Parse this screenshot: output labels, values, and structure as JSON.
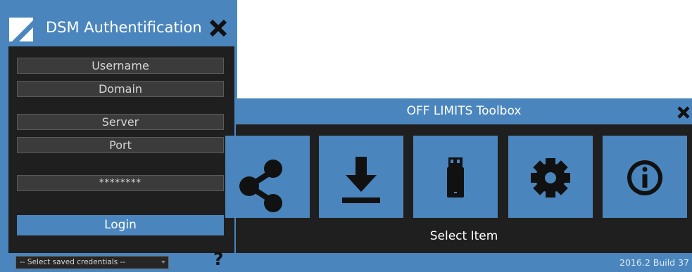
{
  "auth_window": {
    "title": "DSM Authentification",
    "fields": {
      "username": "Username",
      "domain": "Domain",
      "server": "Server",
      "port": "Port",
      "password": "********"
    },
    "login_label": "Login",
    "saved_credentials": "-- Select saved credentials --",
    "help_label": "?"
  },
  "toolbox_window": {
    "title": "OFF LIMITS Toolbox",
    "tiles": [
      {
        "icon": "share-icon"
      },
      {
        "icon": "download-icon"
      },
      {
        "icon": "usb-drive-icon"
      },
      {
        "icon": "gear-icon"
      },
      {
        "icon": "info-icon"
      }
    ],
    "status": "Select Item",
    "build": "2016.2 Build 37"
  },
  "colors": {
    "accent": "#4a86bd",
    "panel": "#1f1f1f",
    "field": "#3b3b3b",
    "text": "#ffffff"
  }
}
